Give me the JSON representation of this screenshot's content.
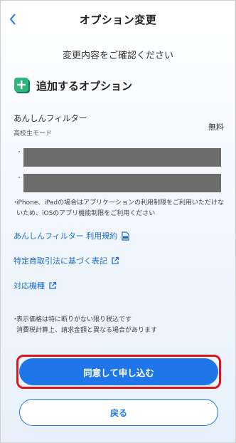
{
  "header": {
    "title": "オプション変更"
  },
  "confirm_text": "変更内容をご確認ください",
  "section": {
    "title": "追加するオプション"
  },
  "option": {
    "name": "あんしんフィルター",
    "mode": "高校生モード",
    "price": "無料",
    "bullets": [
      "・",
      "・"
    ]
  },
  "note1": {
    "bullet": "・",
    "text": "iPhone、iPadの場合はアプリケーションの利用制限をご利用いただけないため、iOSのアプリ機能制限をご利用ください"
  },
  "links": {
    "terms": "あんしんフィルター 利用規約",
    "commerce": "特定商取引法に基づく表記",
    "devices": "対応機種"
  },
  "note2": {
    "bullet": "・",
    "line1": "表示価格は特に断りがない限り税込です",
    "line2": "消費税計算上、請求金額と異なる場合があります"
  },
  "buttons": {
    "apply": "同意して申し込む",
    "back": "戻る"
  },
  "colors": {
    "accent": "#1e76e8",
    "highlight": "#e0141b",
    "icon_green": "#2eb67d"
  }
}
